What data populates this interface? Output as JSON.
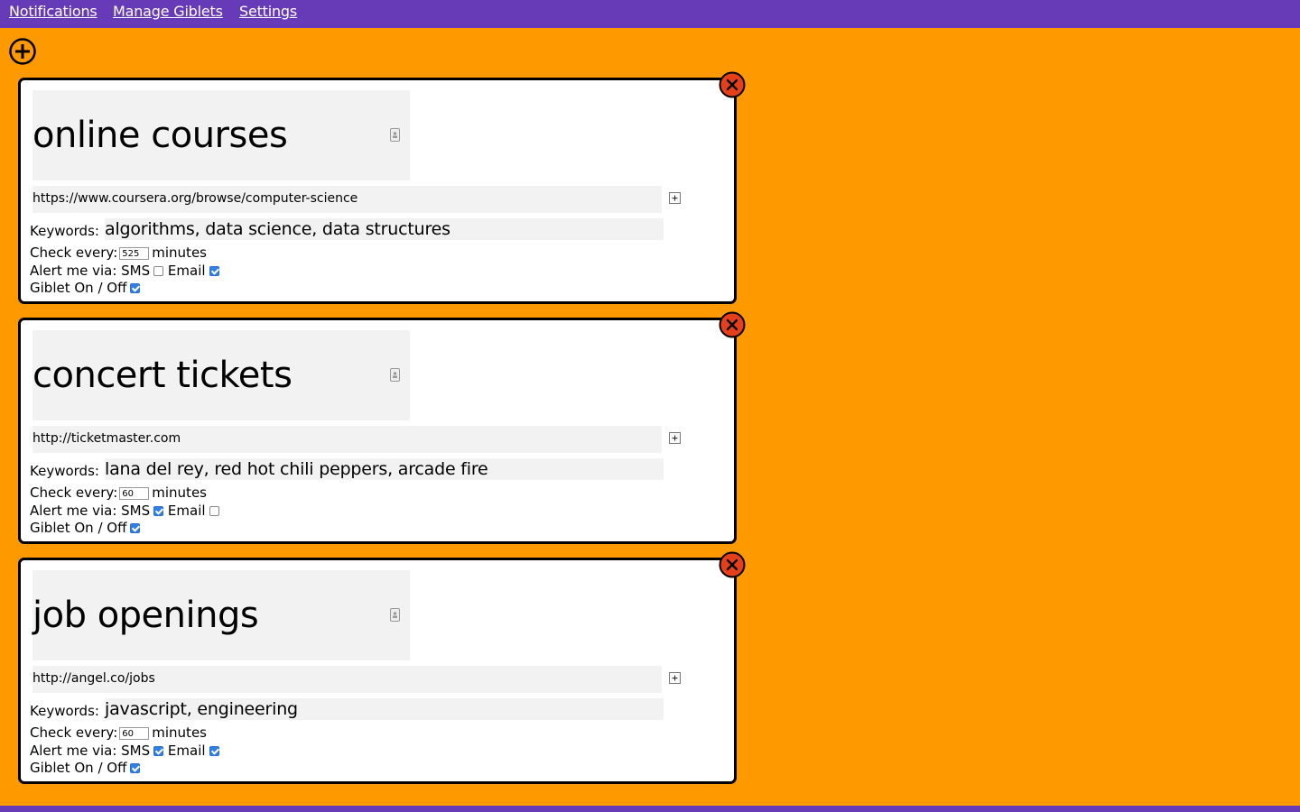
{
  "nav": {
    "notifications": "Notifications",
    "manage": "Manage Giblets",
    "settings": "Settings"
  },
  "colors": {
    "background": "#ff9900",
    "nav_bar": "#673ab7",
    "close_button": "#e5401a",
    "checkbox": "#2f7fe6"
  },
  "labels": {
    "keywords": "Keywords:",
    "check_every": "Check every:",
    "minutes": "minutes",
    "alert_via": "Alert me via: SMS",
    "email": "Email",
    "on_off": "Giblet On / Off"
  },
  "giblets": [
    {
      "title": "online courses",
      "url": "https://www.coursera.org/browse/computer-science",
      "keywords": "algorithms, data science, data structures",
      "interval": "525",
      "sms": false,
      "email": true,
      "enabled": true
    },
    {
      "title": "concert tickets",
      "url": "http://ticketmaster.com",
      "keywords": "lana del rey, red hot chili peppers, arcade fire",
      "interval": "60",
      "sms": true,
      "email": false,
      "enabled": true
    },
    {
      "title": "job openings",
      "url": "http://angel.co/jobs",
      "keywords": "javascript, engineering",
      "interval": "60",
      "sms": true,
      "email": true,
      "enabled": true
    }
  ]
}
